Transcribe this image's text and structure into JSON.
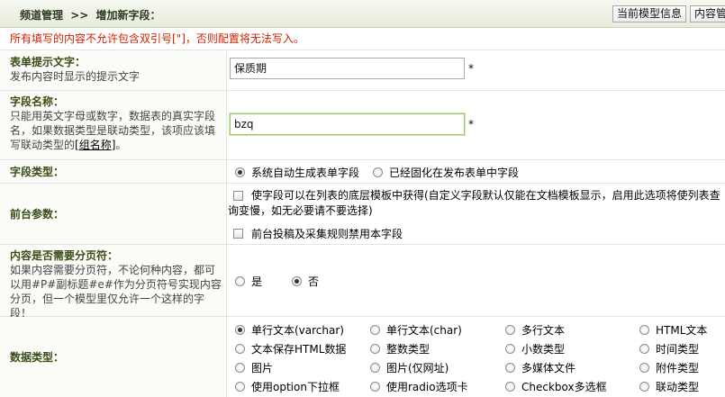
{
  "header": {
    "crumb_root": "频道管理",
    "crumb_sep": ">>",
    "crumb_current": "增加新字段：",
    "btn_model_info": "当前模型信息",
    "btn_content": "内容管理"
  },
  "notice": "所有填写的内容不允许包含双引号[\"]，否则配置将无法写入。",
  "form_label": {
    "title": "表单提示文字：",
    "desc": "发布内容时显示的提示文字",
    "value": "保质期",
    "required_mark": "*"
  },
  "field_name": {
    "title": "字段名称：",
    "desc_part1": "只能用英文字母或数字，数据表的真实字段名，如果数据类型是联动类型，该项应该填写联动类型的",
    "desc_link": "[组名称]",
    "desc_part2": "。",
    "value": "bzq",
    "required_mark": "*"
  },
  "field_type": {
    "title": "字段类型：",
    "options": [
      "系统自动生成表单字段",
      "已经固化在发布表单中字段"
    ],
    "selected": 0
  },
  "front_params": {
    "title": "前台参数：",
    "option1": "使字段可以在列表的底层模板中获得(自定义字段默认仅能在文档模板显示，启用此选项将使列表查询变慢，如无必要请不要选择)",
    "option2": "前台投稿及采集规则禁用本字段"
  },
  "pagination": {
    "title": "内容是否需要分页符：",
    "desc": "如果内容需要分页符，不论何种内容，都可以用#P#副标题#e#作为分页符号实现内容分页，但一个模型里仅允许一个这样的字段！",
    "options": [
      "是",
      "否"
    ],
    "selected": 1
  },
  "data_type": {
    "title": "数据类型：",
    "options": [
      "单行文本(varchar)",
      "单行文本(char)",
      "多行文本",
      "HTML文本",
      "文本保存HTML数据",
      "整数类型",
      "小数类型",
      "时间类型",
      "图片",
      "图片(仅网址)",
      "多媒体文件",
      "附件类型",
      "使用option下拉框",
      "使用radio选项卡",
      "Checkbox多选框",
      "联动类型"
    ],
    "selected": 0
  }
}
